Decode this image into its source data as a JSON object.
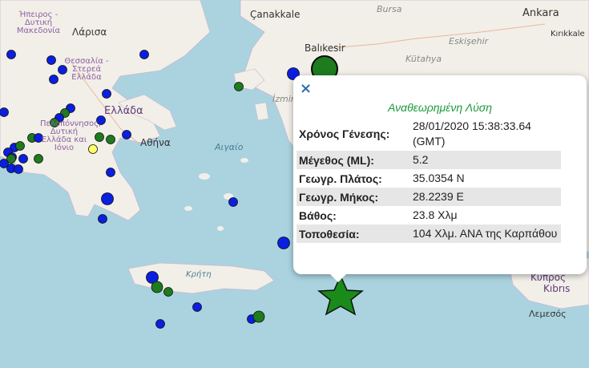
{
  "map": {
    "labels": {
      "country_greece": "Ελλάδα",
      "country_cyprus": "Κύπρος",
      "country_cyprus_tr": "Kıbrıs",
      "city_athens": "Αθήνα",
      "city_larisa": "Λάρισα",
      "city_balikesir": "Balıkesir",
      "city_izmir": "İzmir",
      "city_ankara": "Ankara",
      "city_bursa": "Bursa",
      "city_canakkale": "Çanakkale",
      "city_eskisehir": "Eskişehir",
      "city_kutahya": "Kütahya",
      "city_kirikkale": "Kırıkkale",
      "city_lemesos": "Λεμεσός",
      "region_epirus": "Ήπειρος - Δυτική Μακεδονία",
      "region_thessaly": "Θεσσαλία - Στερεά Ελλάδα",
      "region_peloponnese": "Πελοπόννησος, Δυτική Ελλάδα και Ιόνιο",
      "island_crete": "Κρήτη",
      "sea_aegean": "Αιγαίο"
    },
    "colors": {
      "sea": "#aad3df",
      "land": "#f2efe9",
      "quake_blue": "#0a1fe0",
      "quake_green": "#1e7b1e",
      "quake_yellow": "#ffff66",
      "star_fill": "#1a8a1a"
    },
    "marker_icon": "star-icon"
  },
  "popup": {
    "close_label": "×",
    "title": "Αναθεωρημένη Λύση",
    "rows": [
      {
        "label": "Χρόνος Γένεσης:",
        "value": "28/01/2020 15:38:33.64 (GMT)"
      },
      {
        "label": "Μέγεθος (ML):",
        "value": "5.2"
      },
      {
        "label": "Γεωγρ. Πλάτος:",
        "value": "35.0354 N"
      },
      {
        "label": "Γεωγρ. Μήκος:",
        "value": "28.2239 E"
      },
      {
        "label": "Βάθος:",
        "value": "23.8 Χλμ"
      },
      {
        "label": "Τοποθεσία:",
        "value": "104 Χλμ. ΑΝΑ της Καρπάθου"
      }
    ]
  }
}
